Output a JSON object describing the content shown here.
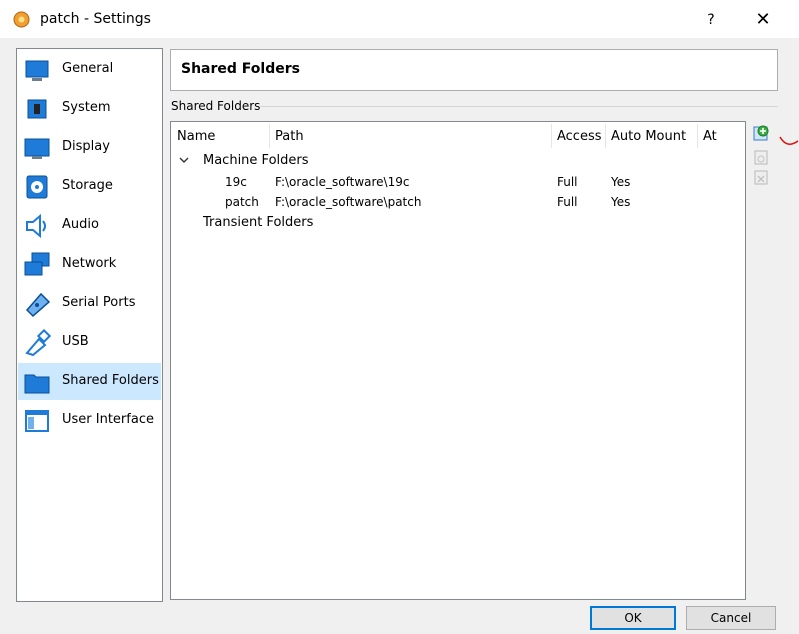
{
  "window": {
    "title": "patch - Settings",
    "help_label": "?",
    "close_label": "✕"
  },
  "sidebar": {
    "items": [
      {
        "label": "General",
        "icon": "general-icon"
      },
      {
        "label": "System",
        "icon": "system-icon"
      },
      {
        "label": "Display",
        "icon": "display-icon"
      },
      {
        "label": "Storage",
        "icon": "storage-icon"
      },
      {
        "label": "Audio",
        "icon": "audio-icon"
      },
      {
        "label": "Network",
        "icon": "network-icon"
      },
      {
        "label": "Serial Ports",
        "icon": "serial-ports-icon"
      },
      {
        "label": "USB",
        "icon": "usb-icon"
      },
      {
        "label": "Shared Folders",
        "icon": "shared-folders-icon",
        "selected": true
      },
      {
        "label": "User Interface",
        "icon": "user-interface-icon"
      }
    ]
  },
  "main": {
    "header_title": "Shared Folders",
    "group_label": "Shared Folders",
    "columns": [
      "Name",
      "Path",
      "Access",
      "Auto Mount",
      "At"
    ],
    "machine_folders_label": "Machine Folders",
    "rows": [
      {
        "name": "19c",
        "path": "F:\\oracle_software\\19c",
        "access": "Full",
        "auto_mount": "Yes"
      },
      {
        "name": "patch",
        "path": "F:\\oracle_software\\patch",
        "access": "Full",
        "auto_mount": "Yes"
      }
    ],
    "transient_folders_label": "Transient Folders"
  },
  "buttons": {
    "ok_label": "OK",
    "cancel_label": "Cancel"
  },
  "colors": {
    "selection": "#cce8ff",
    "accent": "#0078d7",
    "add_icon_green": "#3cb043"
  }
}
